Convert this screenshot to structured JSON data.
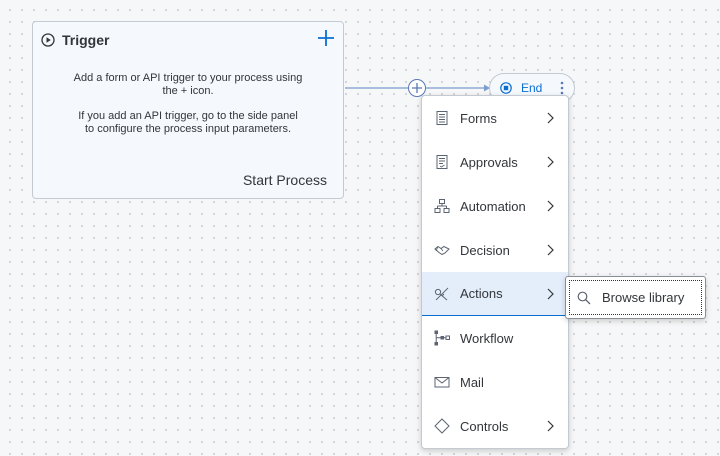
{
  "trigger": {
    "title": "Trigger",
    "description_line1": "Add a form or API trigger to your process using the + icon.",
    "description_line2": "If you add an API trigger, go to the side panel to configure the process input parameters.",
    "footer": "Start Process",
    "icons": {
      "header": "play-circle-icon",
      "add": "plus-icon"
    }
  },
  "end_node": {
    "label": "End",
    "icon": "stop-circle-icon",
    "more_icon": "vertical-ellipsis-icon"
  },
  "menu": {
    "items": [
      {
        "label": "Forms",
        "icon": "form-icon",
        "has_submenu": true
      },
      {
        "label": "Approvals",
        "icon": "approval-icon",
        "has_submenu": true
      },
      {
        "label": "Automation",
        "icon": "automation-icon",
        "has_submenu": true
      },
      {
        "label": "Decision",
        "icon": "decision-icon",
        "has_submenu": true
      },
      {
        "label": "Actions",
        "icon": "actions-icon",
        "has_submenu": true,
        "selected": true
      },
      {
        "label": "Workflow",
        "icon": "workflow-icon",
        "has_submenu": false
      },
      {
        "label": "Mail",
        "icon": "mail-icon",
        "has_submenu": false
      },
      {
        "label": "Controls",
        "icon": "controls-icon",
        "has_submenu": true
      }
    ]
  },
  "submenu": {
    "label": "Browse library",
    "icon": "search-icon"
  },
  "colors": {
    "accent": "#0a6ed1",
    "selected_bg": "#e4eefa",
    "connector": "#7a9ccf"
  }
}
